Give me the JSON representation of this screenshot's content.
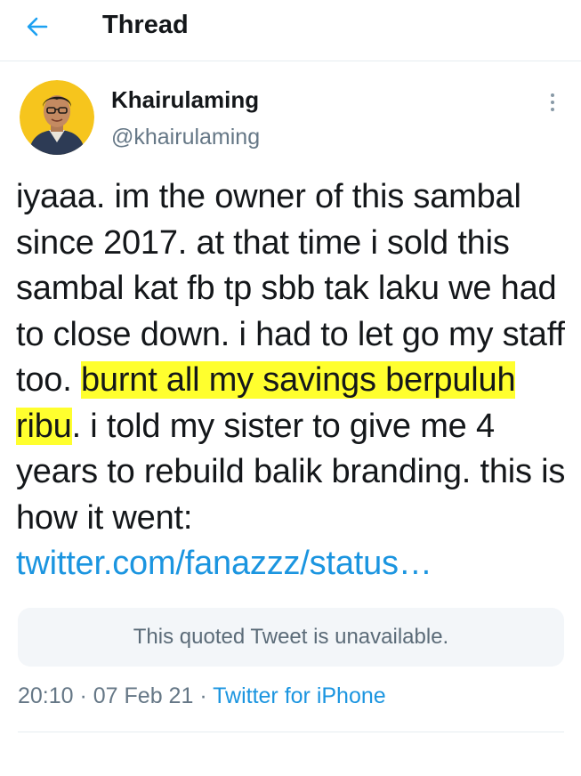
{
  "header": {
    "title": "Thread",
    "back_icon": "arrow-left-icon",
    "accent_color": "#1da1f2"
  },
  "tweet": {
    "author": {
      "name": "Khairulaming",
      "handle": "@khairulaming",
      "avatar_icon": "avatar-photo"
    },
    "more_icon": "more-vertical-icon",
    "text_plain_1": "iyaaa. im the owner of this sambal since 2017. at that time i sold this sambal kat fb tp sbb tak laku we had to close down. i had to let go my staff too. ",
    "text_highlight": "burnt all my savings berpuluh ribu",
    "text_plain_2": ". i told my sister to give me 4 years to rebuild balik branding. this is how it went: ",
    "link_text": "twitter.com/fanazzz/status…",
    "quoted_unavailable": "This quoted Tweet is unavailable.",
    "time": "20:10",
    "separator_1": " · ",
    "date": "07 Feb 21",
    "separator_2": " · ",
    "source": "Twitter for iPhone",
    "highlight_color": "#ffff2e",
    "link_color": "#1b95e0"
  }
}
